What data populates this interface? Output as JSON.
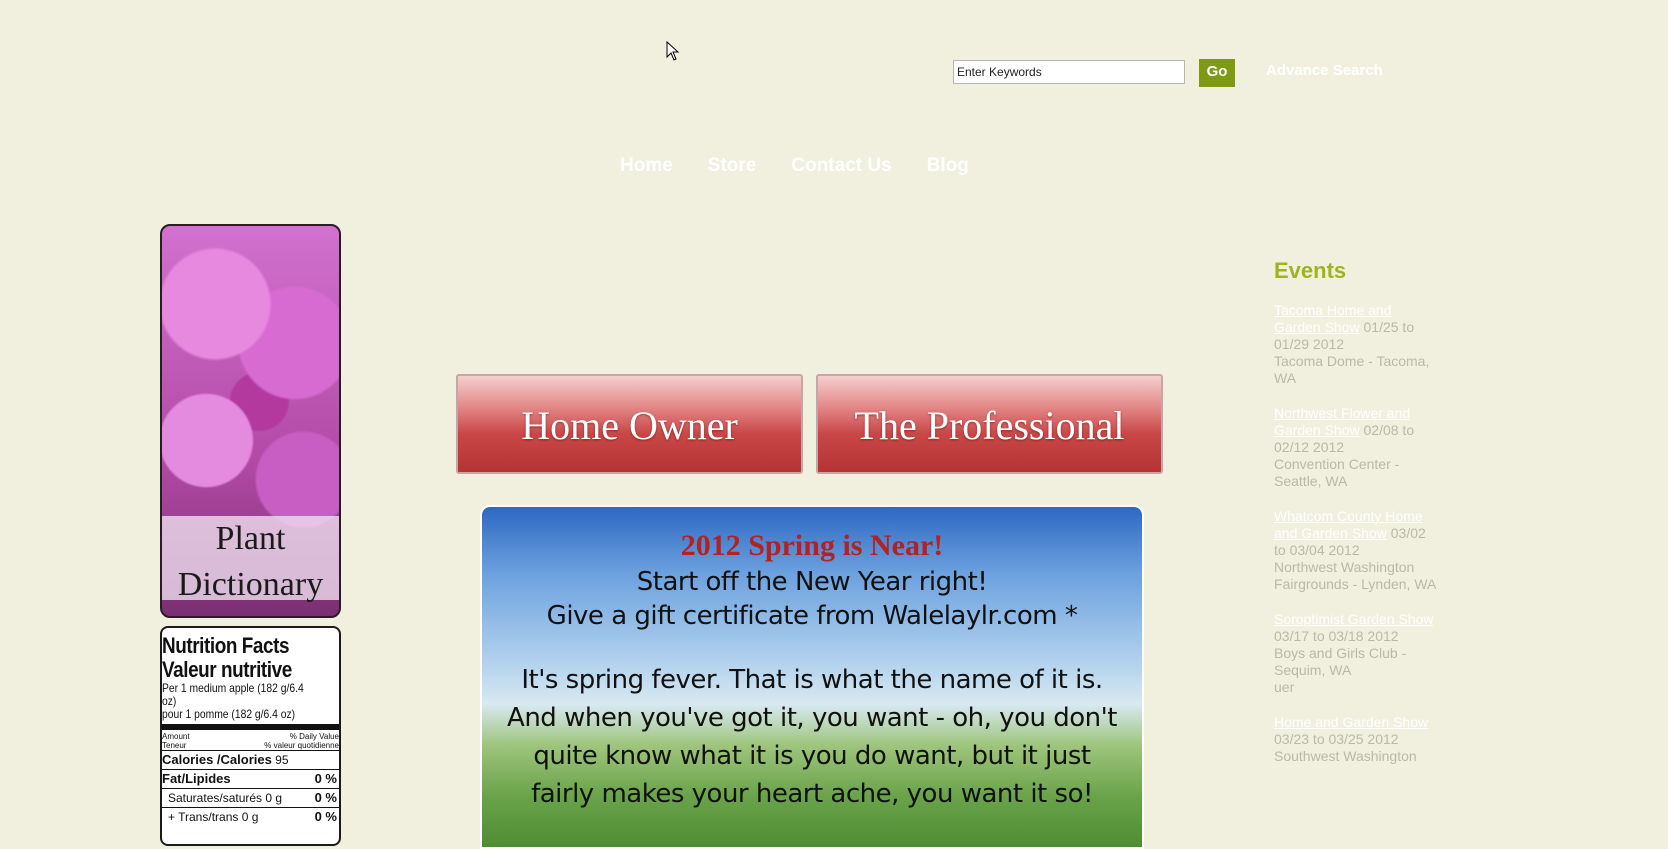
{
  "search": {
    "placeholder": "Enter Keywords",
    "value": "Enter Keywords",
    "go_label": "Go",
    "advance_label": "Advance Search"
  },
  "nav": [
    "Home",
    "Store",
    "Contact Us",
    "Blog"
  ],
  "left": {
    "plant_label_1": "Plant",
    "plant_label_2": "Dictionary",
    "nutrition": {
      "title1": "Nutrition Facts",
      "title2": "Valeur nutritive",
      "serving1": "Per 1 medium apple (182 g/6.4 oz)",
      "serving2": "pour 1 pomme (182 g/6.4 oz)",
      "amount": "Amount",
      "teneur": "Teneur",
      "dv": "% Daily Value",
      "vq": "% valeur quotidienne",
      "calories_label": "Calories /Calories",
      "calories_value": "95",
      "fat_label": "Fat/Lipides",
      "fat_value": "0 %",
      "sat_label": "Saturates/saturés 0 g",
      "sat_value": "0 %",
      "trans_label": "+ Trans/trans 0 g",
      "trans_value": "0 %"
    }
  },
  "buttons": {
    "home_owner": "Home Owner",
    "professional": "The Professional"
  },
  "banner": {
    "line1": "2012 Spring is Near!",
    "line2": "Start off the New Year right!",
    "line3": "Give a gift certificate from Walelaylr.com *",
    "line4": "It's spring fever. That is what the name of it is. And when you've got it, you want - oh, you don't quite know what it is you do want, but it just fairly makes your heart ache, you want it so!"
  },
  "events": {
    "heading": "Events",
    "items": [
      {
        "title": "Tacoma Home and Garden Show",
        "dates": " 01/25 to 01/29 2012",
        "location": "Tacoma Dome - Tacoma, WA"
      },
      {
        "title": "Northwest Flower and Garden Show",
        "dates": " 02/08 to 02/12 2012",
        "location": "Convention Center - Seattle, WA"
      },
      {
        "title": "Whatcom County Home and Garden Show",
        "dates": " 03/02 to 03/04 2012",
        "location": "Northwest Washington Fairgrounds - Lynden, WA"
      },
      {
        "title": "Soroptimist Garden Show",
        "dates": " 03/17 to 03/18 2012",
        "location": "Boys and Girls Club - Sequim, WA",
        "extra": "uer"
      },
      {
        "title": "Home and Garden Show",
        "dates": " 03/23 to 03/25 2012",
        "location": "Southwest Washington"
      }
    ]
  },
  "colors": {
    "background": "#f1f0df",
    "accent_green": "#7d9a12",
    "events_heading": "#9bb51c",
    "button_red": "#c94747"
  }
}
